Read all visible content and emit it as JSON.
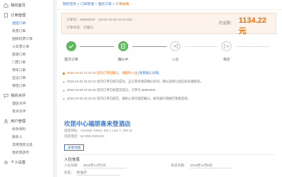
{
  "sidebar": {
    "sections": [
      {
        "label": "我的首页",
        "icon": "home-icon",
        "items": []
      },
      {
        "label": "订单管理",
        "icon": "document-icon",
        "items": [
          "酒店订单",
          "机票订单",
          "国际机票订单",
          "火车票订单",
          "旅游订单",
          "门票订单",
          "用车订单",
          "签证订单",
          "保险订单"
        ]
      },
      {
        "label": "我的点评",
        "icon": "comment-icon",
        "items": [
          "酒店点评",
          "景点点评"
        ]
      },
      {
        "label": "用户管理",
        "icon": "user-icon",
        "items": [
          "修改资料",
          "联系人",
          "常用旅客信息",
          "我的旅游币"
        ]
      },
      {
        "label": "个人设置",
        "icon": "gear-icon",
        "items": []
      }
    ],
    "active_item": "酒店订单"
  },
  "breadcrumb": {
    "items": [
      "我的首页",
      "订单管理",
      "酒店订单"
    ],
    "current": "订单详情",
    "sep": " > "
  },
  "order": {
    "number_label": "订单号：",
    "number": "58584825",
    "time": "(2016-10-03 22:41:02)",
    "status_label": "订单状态：",
    "status": "已确认",
    "total_label": "总金额：",
    "total": "1134.22 元"
  },
  "steps": [
    {
      "label": "提交订单",
      "done": true
    },
    {
      "label": "确认中",
      "done": true
    },
    {
      "label": "入住",
      "done": false
    },
    {
      "label": "离店",
      "done": false
    }
  ],
  "logs": [
    {
      "time": "2016-10-03 22:41:03",
      "text": "您的订单已确认，请按时入住",
      "link": "[查看确认详情]"
    },
    {
      "time": "2016-10-03 22:33:12",
      "text": "您的订单已提交成功，正在等待酒店确认房间，确认后将以短信形式通知您。",
      "link": ""
    },
    {
      "time": "2016-10-03 22:41:02",
      "text": "您的订单已经提交成功，订单号 58584825",
      "link": ""
    },
    {
      "time": "2016-10-03 22:41:02",
      "text": "您的订单已提交，请耐心等待酒店确认，如有疑问请拨打客服电话。",
      "link": ""
    }
  ],
  "hotel": {
    "name": "坎昆中心福朋喜来登酒店",
    "address_label": "酒店地址：",
    "address": "Avenida Tulum, M2 L Lote 7, SM 12",
    "phone_label": "酒店电话：",
    "phone": "52-998-2830101",
    "map_button": "查看地图"
  },
  "stay": {
    "title": "入住信息",
    "checkin_label": "入住日期：",
    "checkin": "2016年11月7日",
    "checkout_label": "离店日期：",
    "checkout": "2016年11月9日",
    "room_label": "房型：",
    "room": "标准间"
  }
}
